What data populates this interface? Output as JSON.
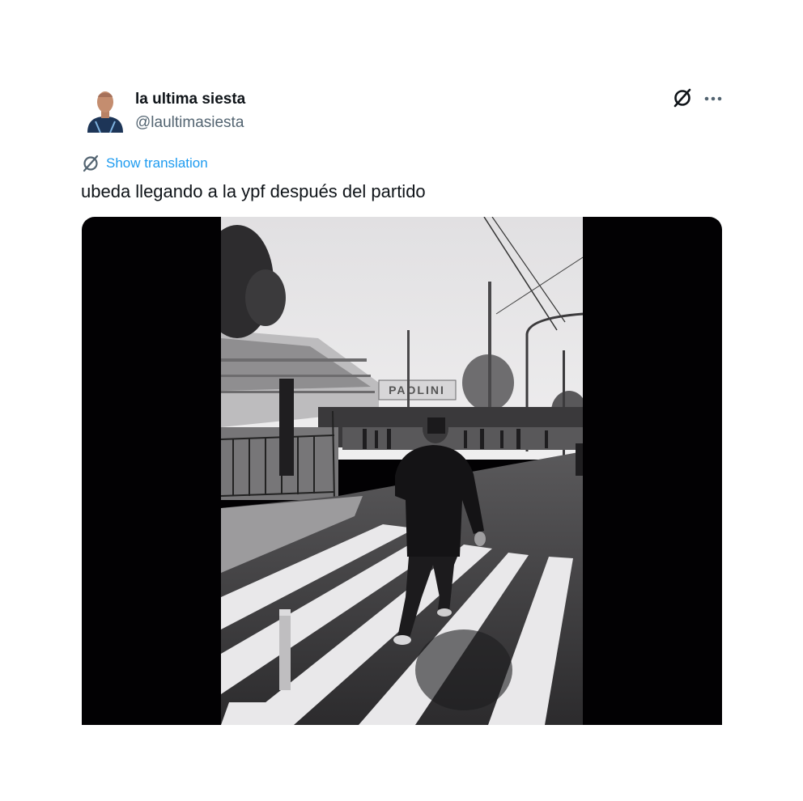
{
  "author": {
    "display_name": "la ultima siesta",
    "handle": "@laultimasiesta"
  },
  "tweet": {
    "translate_label": "Show translation",
    "text": "ubeda llegando a la ypf después del partido"
  },
  "media": {
    "sign_text": "PAOLINI"
  },
  "colors": {
    "link": "#1d9bf0",
    "text": "#0f1419",
    "secondary": "#536471",
    "media_background": "#020103"
  },
  "icons": [
    "avatar",
    "grok-icon",
    "more-icon",
    "translate-icon"
  ]
}
